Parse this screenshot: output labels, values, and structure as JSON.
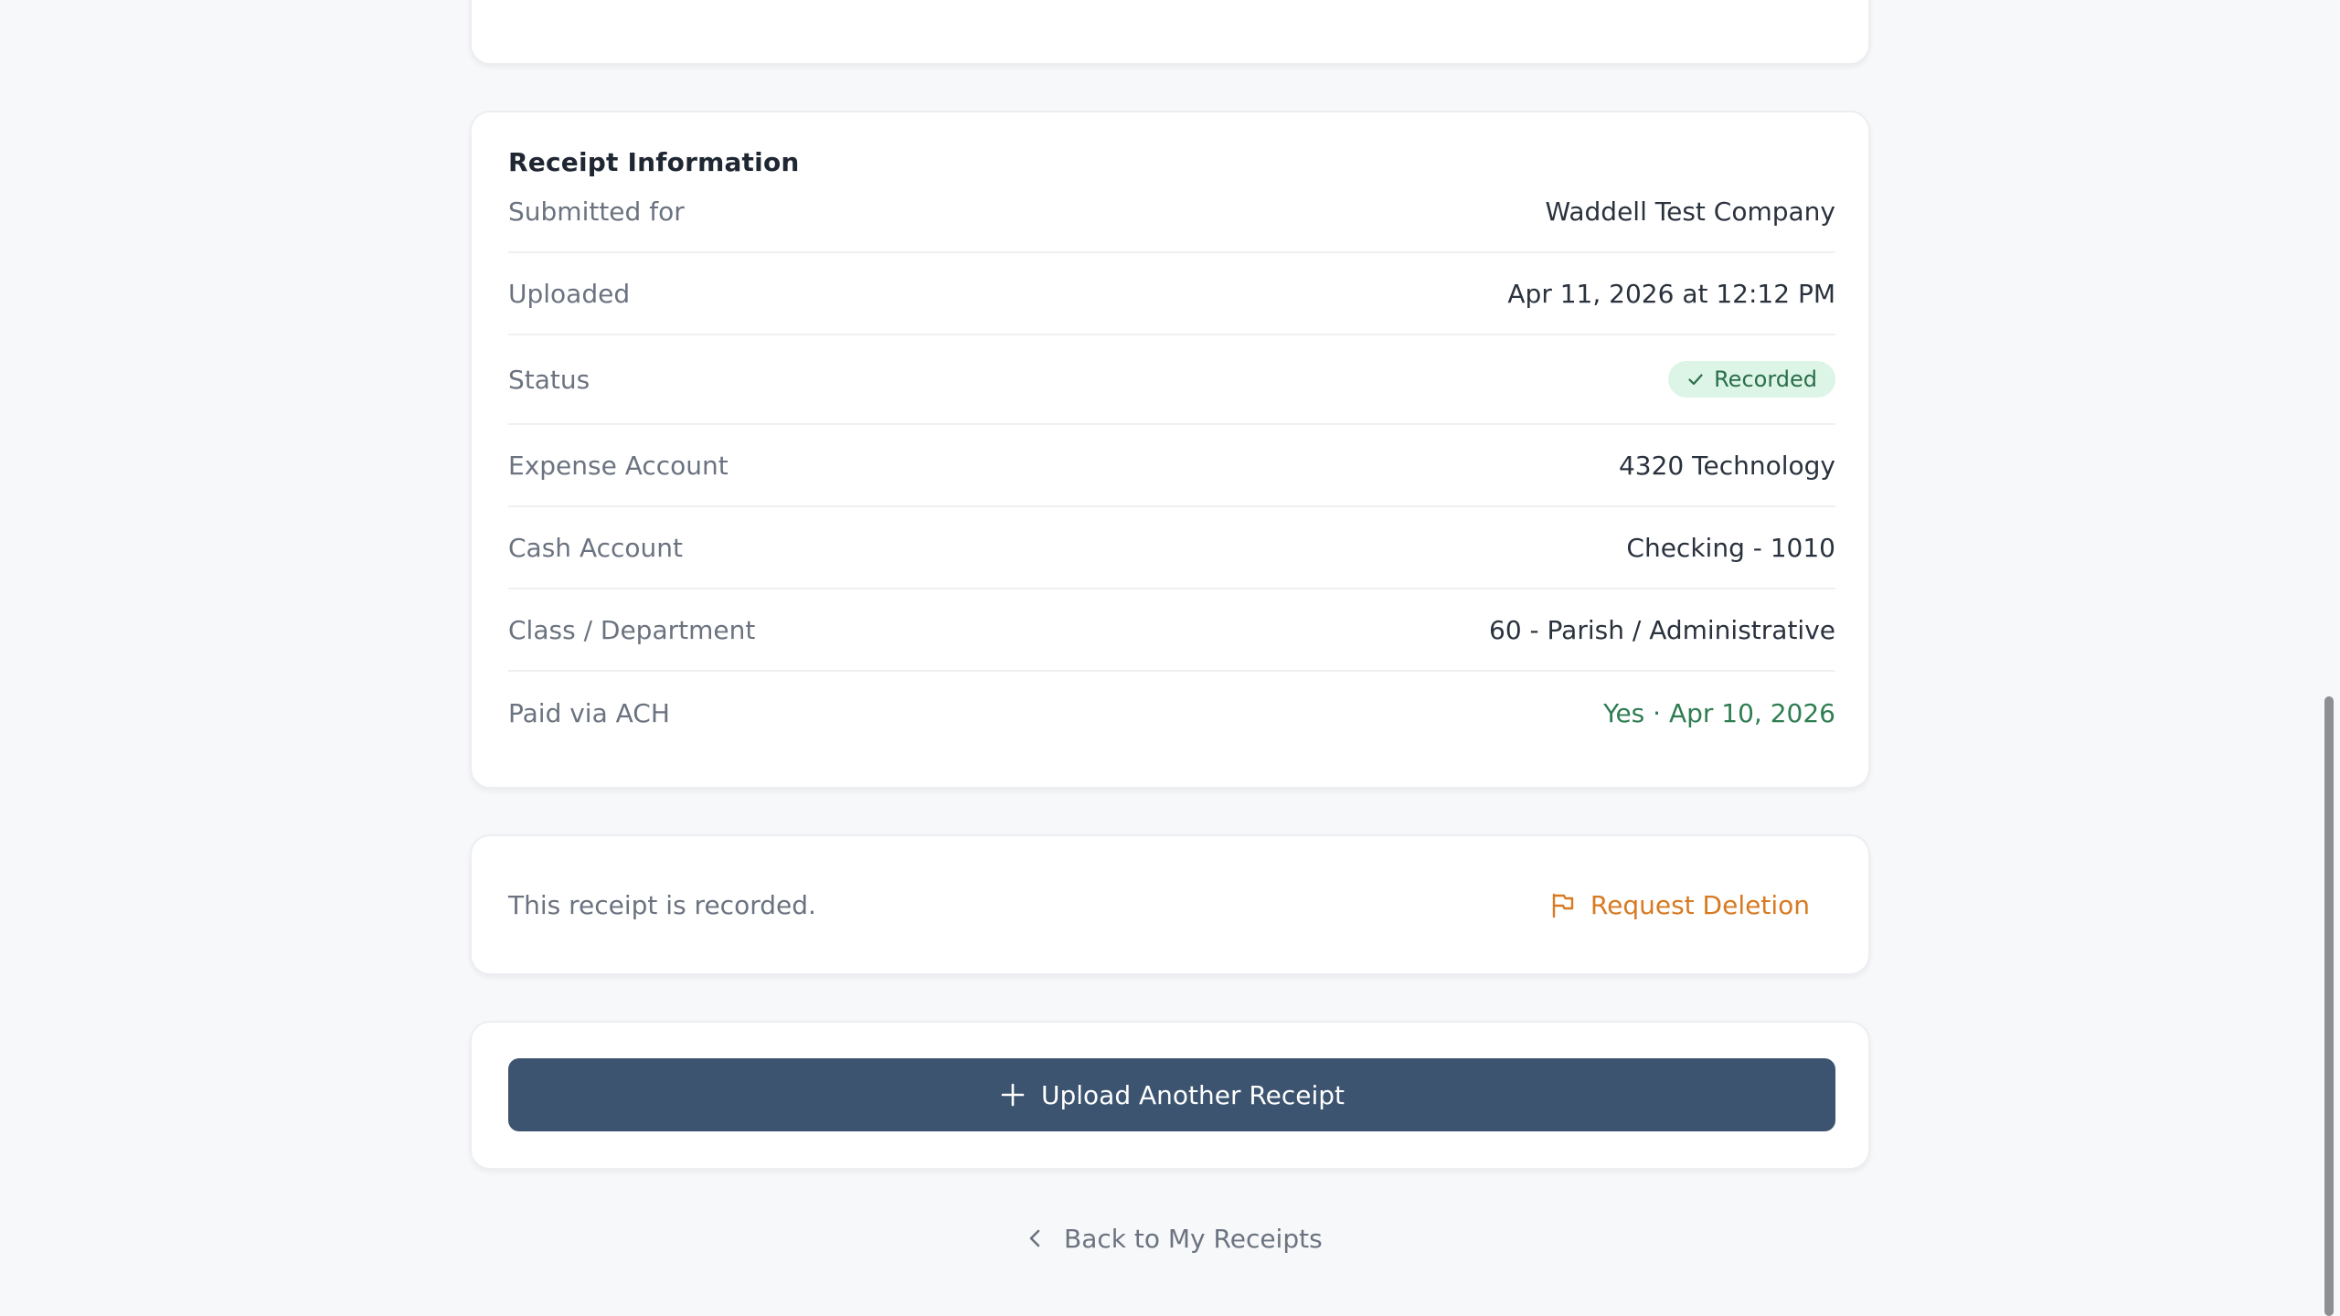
{
  "receipt_info": {
    "title": "Receipt Information",
    "rows": [
      {
        "label": "Submitted for",
        "value": "Waddell Test Company"
      },
      {
        "label": "Uploaded",
        "value": "Apr 11, 2026 at 12:12 PM"
      },
      {
        "label": "Status",
        "value": "Recorded"
      },
      {
        "label": "Expense Account",
        "value": "4320 Technology"
      },
      {
        "label": "Cash Account",
        "value": "Checking - 1010"
      },
      {
        "label": "Class / Department",
        "value": "60 - Parish / Administrative"
      },
      {
        "label": "Paid via ACH",
        "value": "Yes · Apr 10, 2026"
      }
    ]
  },
  "action_card": {
    "message": "This receipt is recorded.",
    "request_deletion_label": "Request Deletion"
  },
  "upload": {
    "button_label": "Upload Another Receipt"
  },
  "back": {
    "label": "Back to My Receipts"
  },
  "icons": {
    "status": "check-icon",
    "request_deletion": "flag-icon",
    "upload": "plus-icon",
    "back": "chevron-left-icon"
  },
  "colors": {
    "page_background": "#f7f8fa",
    "primary_button": "#3c5470",
    "status_badge_bg": "#dcf5e7",
    "status_badge_text": "#2b6e49",
    "ach_text": "#2f7d52",
    "deletion_text": "#d77a22"
  }
}
